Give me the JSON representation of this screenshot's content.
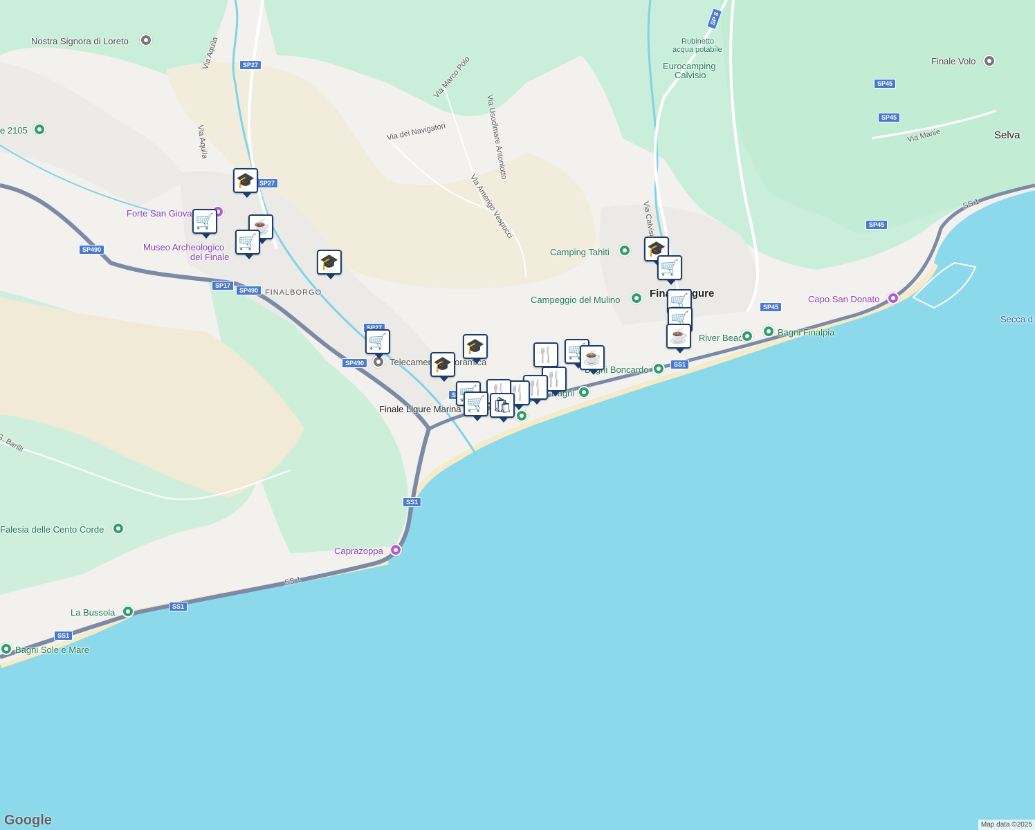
{
  "colors": {
    "sea": "#8dd9ec",
    "land": "#f3f1ee",
    "forest": "#c9eeda",
    "sand": "#f2ecdc",
    "road": "#7c8aa6",
    "river": "#7fd3e6",
    "marker_border": "#1b3e6e"
  },
  "places": {
    "nostra_signora": "Nostra Signora di Loreto",
    "forte": "Forte San Giova",
    "museo_l1": "Museo Archeologico",
    "museo_l2": "del Finale",
    "finalborgo": "FINALBORGO",
    "telecamera": "Telecamera Panoramica",
    "finale_marina": "Finale Ligure Marina",
    "finale_ligure": "Finale Ligure",
    "eurocamping_l1": "Eurocamping",
    "eurocamping_l2": "Calvisio",
    "rubinetto_l1": "Rubinetto",
    "rubinetto_l2": "acqua potabile",
    "camping_tahiti": "Camping Tahiti",
    "campeggio_mulino": "Campeggio del Mulino",
    "finale_volo": "Finale Volo",
    "selva": "Selva",
    "capo_san_donato": "Capo San Donato",
    "secca": "Secca d",
    "bagni_finalpia": "Bagni Finalpia",
    "river_beach": "River Beach",
    "bagni_boncardo": "Bagni Boncardo",
    "bagni_x": "Bagni",
    "caprazoppa": "Caprazoppa",
    "falesia": "Falesia delle Cento Corde",
    "la_bussola": "La Bussola",
    "bagni_sole": "Bagni Sole e Mare",
    "area_2105": "e 2105"
  },
  "streets": {
    "via_aquila_1": "Via Aquila",
    "via_aquila_2": "Via Aquila",
    "via_marco_polo": "Via Marco Polo",
    "via_usodimare": "Via Usodimare Antoniotto",
    "via_navigatori": "Via dei Navigatori",
    "via_vespucci": "Via Amerigo Vespucci",
    "via_calvisio": "Via Calvisio",
    "via_manie": "Via Manie",
    "via_barilli": "G. Barilli",
    "ss1_label": "SS 1",
    "ss1_label2": "SS 1"
  },
  "shields": {
    "sp27a": "SP27",
    "sp27b": "SP27",
    "sp27c": "SP27",
    "sp490a": "SP490",
    "sp490b": "SP490",
    "sp490c": "SP490",
    "sp17": "SP17",
    "sp8": "SP 8",
    "sp45a": "SP45",
    "sp45b": "SP45",
    "sp45c": "SP45",
    "sp45d": "SP45",
    "ss1a": "SS1",
    "ss1b": "SS1",
    "ss1c": "SS1",
    "ss1d": "SS1",
    "sp_marina": "SP"
  },
  "icons": {
    "school": "🎓",
    "cart": "🛒",
    "cafe": "☕",
    "restaurant": "🍴",
    "shop": "🛍"
  },
  "footer": {
    "google": "Google",
    "attribution": "Map data ©2025"
  }
}
